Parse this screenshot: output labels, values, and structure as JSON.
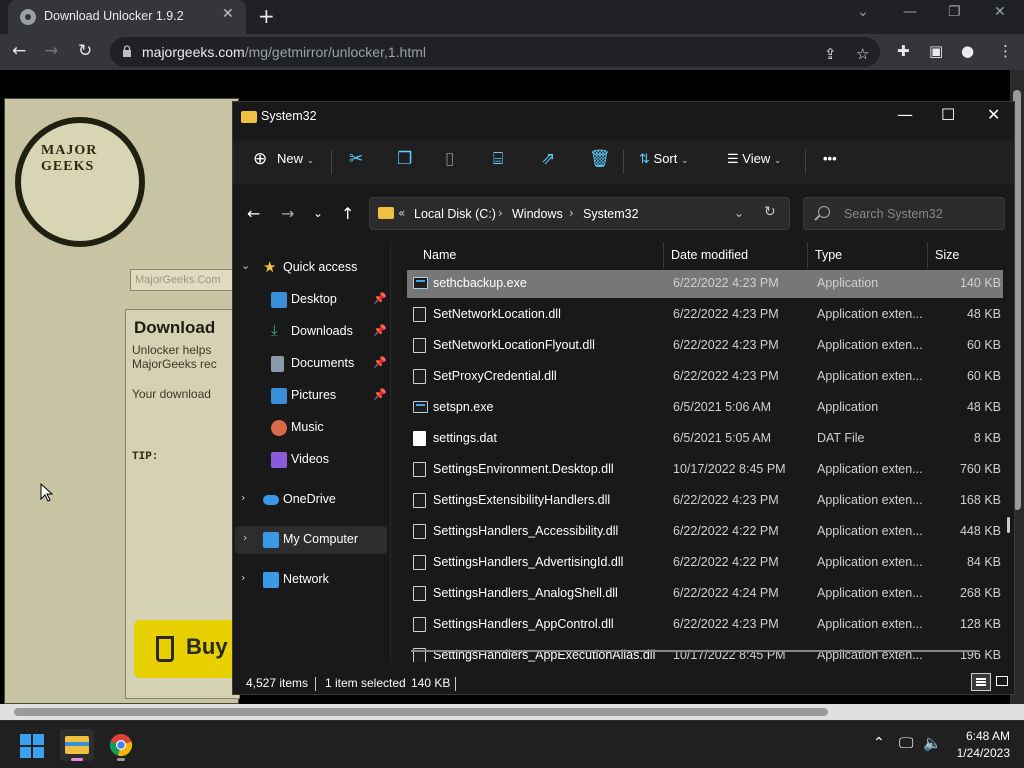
{
  "browser": {
    "tab_title": "Download Unlocker 1.9.2",
    "tab_close": "✕",
    "new_tab": "+",
    "url_domain": "majorgeeks.com",
    "url_path": "/mg/getmirror/unlocker,1.html",
    "controls": {
      "minimize": "—",
      "restore": "❐",
      "close": "✕",
      "tabsearch": "⌄"
    }
  },
  "page": {
    "logo_text": "MAJOR GEEKS",
    "search_placeholder": "MajorGeeks.Com",
    "heading": "Download",
    "line1": "Unlocker helps",
    "line2": "MajorGeeks rec",
    "line3": "Your download",
    "tip": "TIP:",
    "buy": "Buy"
  },
  "explorer": {
    "title": "System32",
    "commands": {
      "new": "New",
      "sort": "Sort",
      "view": "View",
      "more": "•••"
    },
    "breadcrumb": [
      "Local Disk (C:)",
      "Windows",
      "System32"
    ],
    "breadcrumb_overflow": "«",
    "search_placeholder": "Search System32",
    "nav": {
      "quick_access": "Quick access",
      "desktop": "Desktop",
      "downloads": "Downloads",
      "documents": "Documents",
      "pictures": "Pictures",
      "music": "Music",
      "videos": "Videos",
      "onedrive": "OneDrive",
      "my_computer": "My Computer",
      "network": "Network"
    },
    "columns": {
      "name": "Name",
      "date": "Date modified",
      "type": "Type",
      "size": "Size"
    },
    "files": [
      {
        "name": "sethcbackup.exe",
        "date": "6/22/2022 4:23 PM",
        "type": "Application",
        "size": "140 KB",
        "icon": "app"
      },
      {
        "name": "SetNetworkLocation.dll",
        "date": "6/22/2022 4:23 PM",
        "type": "Application exten...",
        "size": "48 KB",
        "icon": "dll"
      },
      {
        "name": "SetNetworkLocationFlyout.dll",
        "date": "6/22/2022 4:23 PM",
        "type": "Application exten...",
        "size": "60 KB",
        "icon": "dll"
      },
      {
        "name": "SetProxyCredential.dll",
        "date": "6/22/2022 4:23 PM",
        "type": "Application exten...",
        "size": "60 KB",
        "icon": "dll"
      },
      {
        "name": "setspn.exe",
        "date": "6/5/2021 5:06 AM",
        "type": "Application",
        "size": "48 KB",
        "icon": "app"
      },
      {
        "name": "settings.dat",
        "date": "6/5/2021 5:05 AM",
        "type": "DAT File",
        "size": "8 KB",
        "icon": "dat"
      },
      {
        "name": "SettingsEnvironment.Desktop.dll",
        "date": "10/17/2022 8:45 PM",
        "type": "Application exten...",
        "size": "760 KB",
        "icon": "dll"
      },
      {
        "name": "SettingsExtensibilityHandlers.dll",
        "date": "6/22/2022 4:23 PM",
        "type": "Application exten...",
        "size": "168 KB",
        "icon": "dll"
      },
      {
        "name": "SettingsHandlers_Accessibility.dll",
        "date": "6/22/2022 4:22 PM",
        "type": "Application exten...",
        "size": "448 KB",
        "icon": "dll"
      },
      {
        "name": "SettingsHandlers_AdvertisingId.dll",
        "date": "6/22/2022 4:22 PM",
        "type": "Application exten...",
        "size": "84 KB",
        "icon": "dll"
      },
      {
        "name": "SettingsHandlers_AnalogShell.dll",
        "date": "6/22/2022 4:24 PM",
        "type": "Application exten...",
        "size": "268 KB",
        "icon": "dll"
      },
      {
        "name": "SettingsHandlers_AppControl.dll",
        "date": "6/22/2022 4:23 PM",
        "type": "Application exten...",
        "size": "128 KB",
        "icon": "dll"
      },
      {
        "name": "SettingsHandlers_AppExecutionAlias.dll",
        "date": "10/17/2022 8:45 PM",
        "type": "Application exten...",
        "size": "196 KB",
        "icon": "dll"
      }
    ],
    "status": {
      "items": "4,527 items",
      "selected": "1 item selected",
      "selected_size": "140 KB"
    }
  },
  "taskbar": {
    "time": "6:48 AM",
    "date": "1/24/2023"
  },
  "colors": {
    "accent": "#60cdff",
    "selected_row": "#777777",
    "folder": "#f0c040"
  }
}
